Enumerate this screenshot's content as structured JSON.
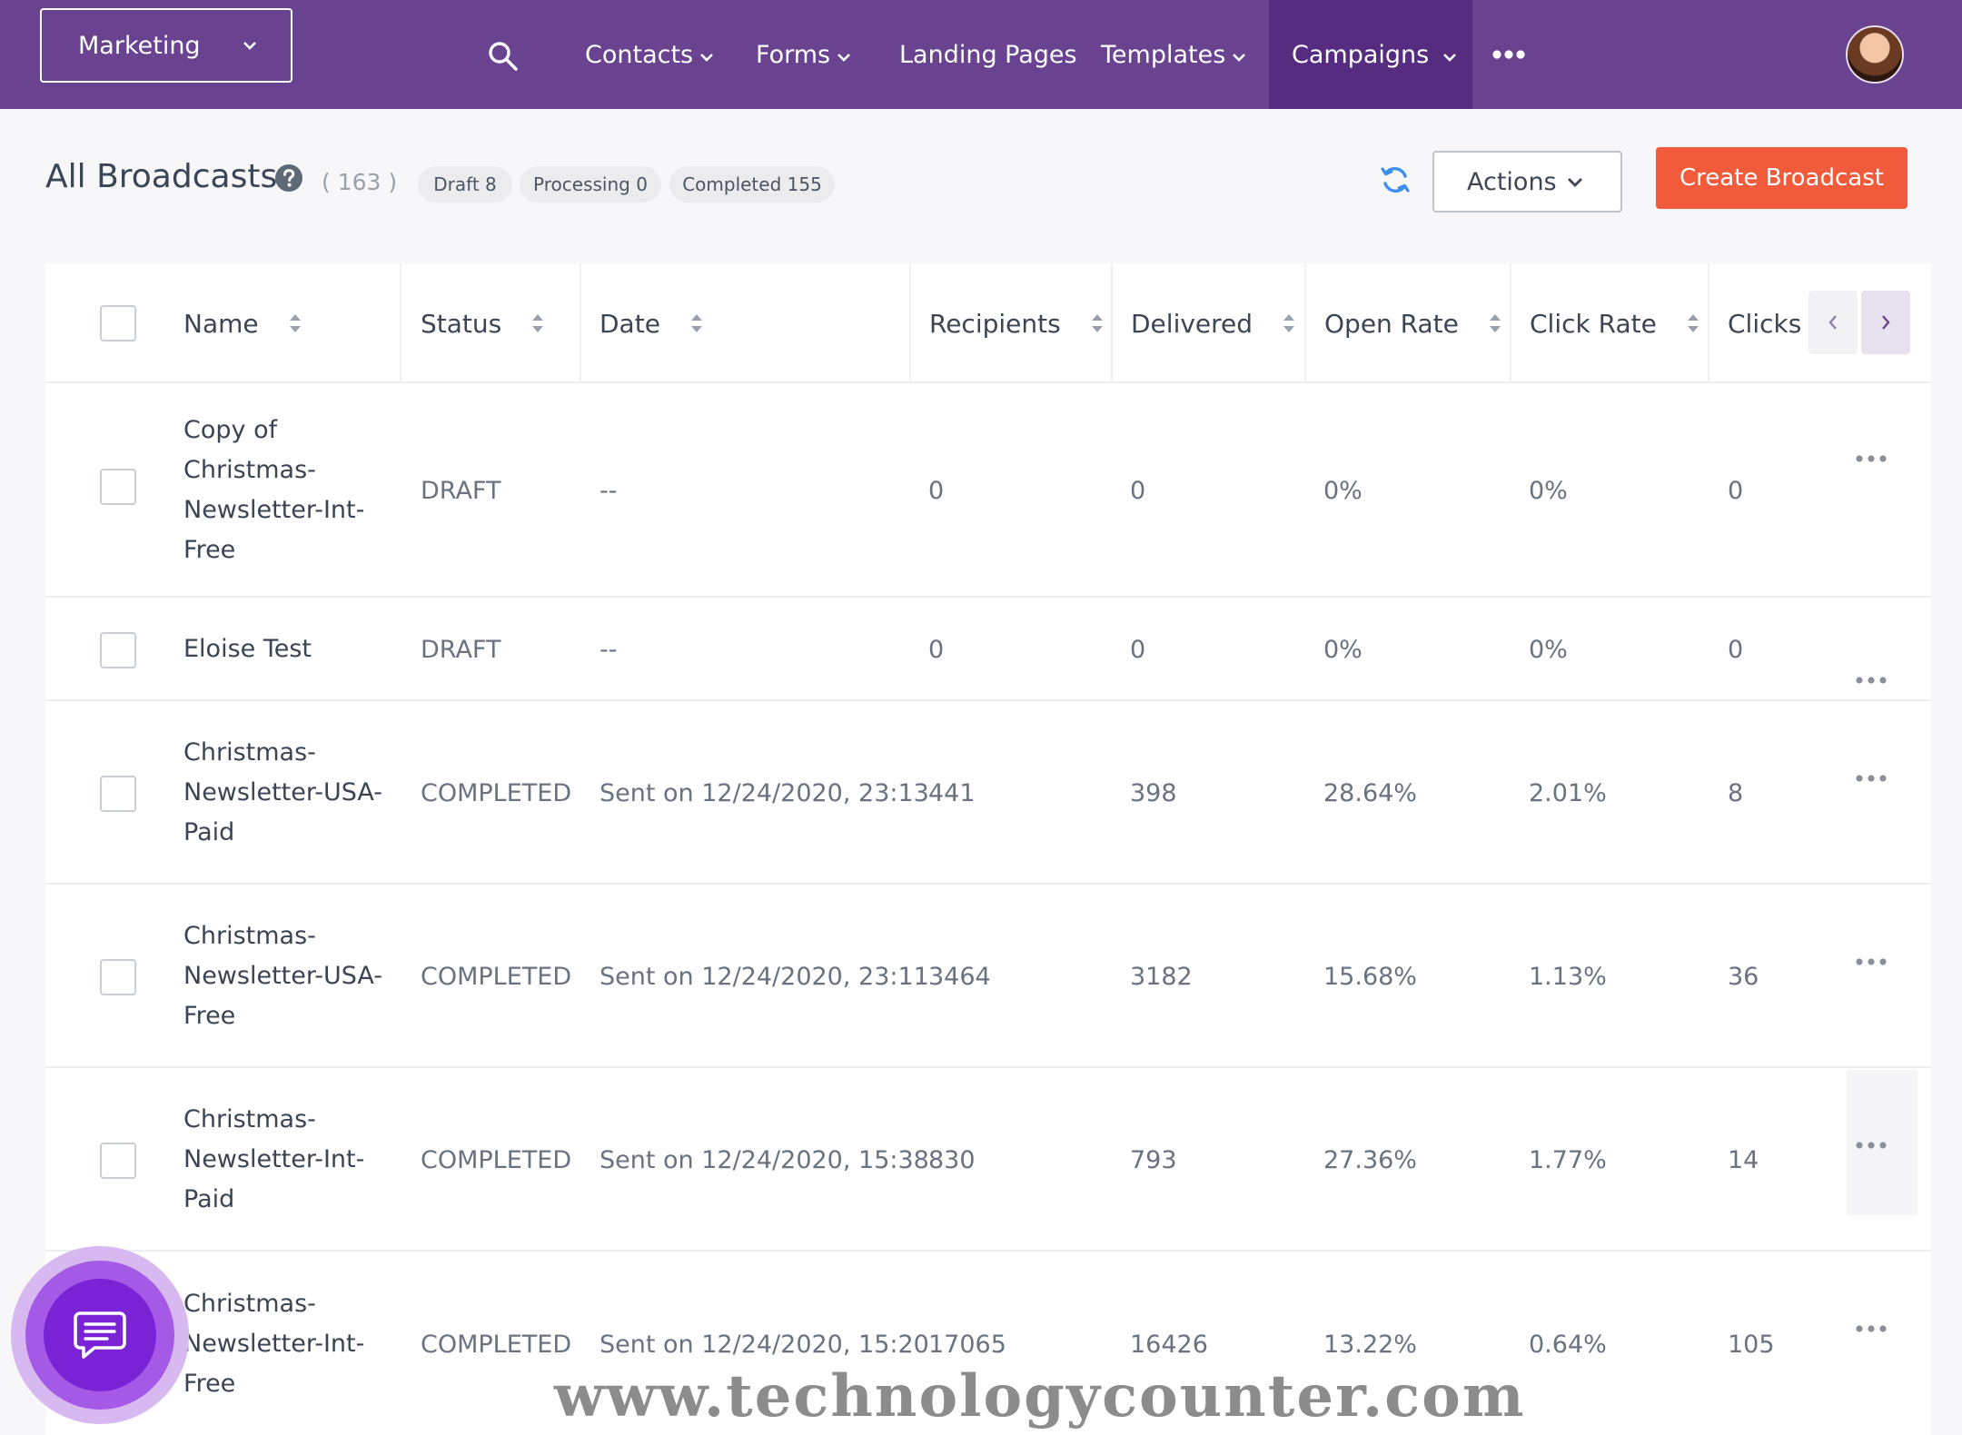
{
  "nav": {
    "workspace": "Marketing",
    "items": [
      {
        "label": "Contacts"
      },
      {
        "label": "Forms"
      },
      {
        "label": "Landing Pages"
      },
      {
        "label": "Templates"
      },
      {
        "label": "Campaigns"
      }
    ],
    "active": "Campaigns",
    "accent": "#6a4390"
  },
  "header": {
    "title": "All Broadcasts",
    "count": "( 163 )",
    "filters": [
      {
        "label": "Draft 8"
      },
      {
        "label": "Processing 0"
      },
      {
        "label": "Completed 155"
      }
    ],
    "actions_label": "Actions",
    "create_label": "Create Broadcast",
    "create_color": "#f15a3a"
  },
  "table": {
    "columns": [
      "Name",
      "Status",
      "Date",
      "Recipients",
      "Delivered",
      "Open Rate",
      "Click Rate",
      "Clicks"
    ],
    "rows": [
      {
        "name": "Copy of Christmas-Newsletter-Int-Free",
        "status": "DRAFT",
        "date": "--",
        "recipients": "0",
        "delivered": "0",
        "open_rate": "0%",
        "click_rate": "0%",
        "clicks": "0"
      },
      {
        "name": "Eloise Test",
        "status": "DRAFT",
        "date": "--",
        "recipients": "0",
        "delivered": "0",
        "open_rate": "0%",
        "click_rate": "0%",
        "clicks": "0"
      },
      {
        "name": "Christmas-Newsletter-USA-Paid",
        "status": "COMPLETED",
        "date": "Sent on 12/24/2020, 23:13",
        "recipients": "441",
        "delivered": "398",
        "open_rate": "28.64%",
        "click_rate": "2.01%",
        "clicks": "8"
      },
      {
        "name": "Christmas-Newsletter-USA-Free",
        "status": "COMPLETED",
        "date": "Sent on 12/24/2020, 23:11",
        "recipients": "3464",
        "delivered": "3182",
        "open_rate": "15.68%",
        "click_rate": "1.13%",
        "clicks": "36"
      },
      {
        "name": "Christmas-Newsletter-Int-Paid",
        "status": "COMPLETED",
        "date": "Sent on 12/24/2020, 15:38",
        "recipients": "830",
        "delivered": "793",
        "open_rate": "27.36%",
        "click_rate": "1.77%",
        "clicks": "14"
      },
      {
        "name": "Christmas-Newsletter-Int-Free",
        "status": "COMPLETED",
        "date": "Sent on 12/24/2020, 15:20",
        "recipients": "17065",
        "delivered": "16426",
        "open_rate": "13.22%",
        "click_rate": "0.64%",
        "clicks": "105"
      }
    ]
  },
  "watermark": "www.technologycounter.com"
}
